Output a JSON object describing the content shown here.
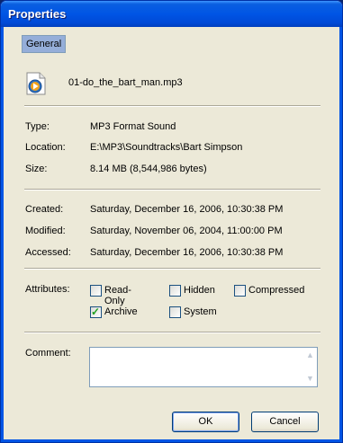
{
  "window": {
    "title": "Properties"
  },
  "tabs": [
    {
      "label": "General",
      "selected": true
    }
  ],
  "file": {
    "name": "01-do_the_bart_man.mp3",
    "icon": "windows-media-audio-file-icon"
  },
  "info": {
    "type_label": "Type:",
    "type_value": "MP3 Format Sound",
    "location_label": "Location:",
    "location_value": "E:\\MP3\\Soundtracks\\Bart Simpson",
    "size_label": "Size:",
    "size_value": "8.14 MB (8,544,986 bytes)"
  },
  "dates": {
    "created_label": "Created:",
    "created_value": "Saturday, December 16, 2006, 10:30:38 PM",
    "modified_label": "Modified:",
    "modified_value": "Saturday, November 06, 2004, 11:00:00 PM",
    "accessed_label": "Accessed:",
    "accessed_value": "Saturday, December 16, 2006, 10:30:38 PM"
  },
  "attributes": {
    "label": "Attributes:",
    "read_only": {
      "label": "Read-Only",
      "checked": false
    },
    "hidden": {
      "label": "Hidden",
      "checked": false
    },
    "compressed": {
      "label": "Compressed",
      "checked": false
    },
    "archive": {
      "label": "Archive",
      "checked": true
    },
    "system": {
      "label": "System",
      "checked": false
    }
  },
  "comment": {
    "label": "Comment:",
    "value": ""
  },
  "buttons": {
    "ok": "OK",
    "cancel": "Cancel"
  },
  "colors": {
    "titlebar": "#0055e5",
    "dialog_bg": "#ece9d8",
    "tab_selected": "#95aed9",
    "check": "#21a121"
  }
}
